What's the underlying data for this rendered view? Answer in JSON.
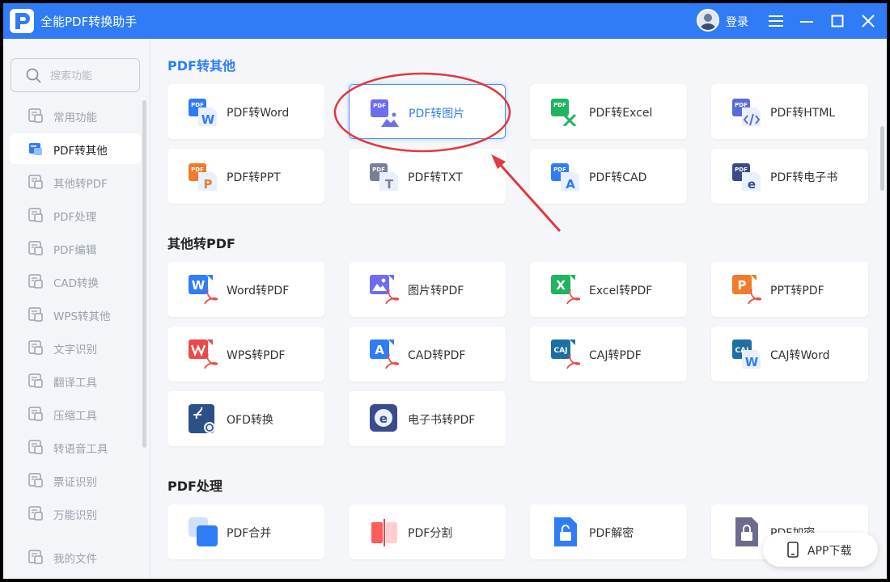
{
  "window": {
    "title": "全能PDF转换助手",
    "login_label": "登录"
  },
  "search": {
    "placeholder": "搜索功能"
  },
  "sidebar": {
    "items": [
      {
        "label": "常用功能",
        "icon": "common-functions-icon"
      },
      {
        "label": "PDF转其他",
        "icon": "pdf-to-other-icon",
        "active": true
      },
      {
        "label": "其他转PDF",
        "icon": "other-to-pdf-icon"
      },
      {
        "label": "PDF处理",
        "icon": "pdf-process-icon"
      },
      {
        "label": "PDF编辑",
        "icon": "pdf-edit-icon"
      },
      {
        "label": "CAD转换",
        "icon": "cad-convert-icon"
      },
      {
        "label": "WPS转其他",
        "icon": "wps-to-other-icon"
      },
      {
        "label": "文字识别",
        "icon": "ocr-icon"
      },
      {
        "label": "翻译工具",
        "icon": "translate-icon"
      },
      {
        "label": "压缩工具",
        "icon": "compress-icon"
      },
      {
        "label": "转语音工具",
        "icon": "text-to-speech-icon"
      },
      {
        "label": "票证识别",
        "icon": "ticket-recognition-icon"
      },
      {
        "label": "万能识别",
        "icon": "universal-recognition-icon"
      },
      {
        "label": "我的文件",
        "icon": "my-files-icon"
      }
    ]
  },
  "sections": {
    "pdf_to_other": {
      "title": "PDF转其他",
      "cards": [
        {
          "label": "PDF转Word"
        },
        {
          "label": "PDF转图片"
        },
        {
          "label": "PDF转Excel"
        },
        {
          "label": "PDF转HTML"
        },
        {
          "label": "PDF转PPT"
        },
        {
          "label": "PDF转TXT"
        },
        {
          "label": "PDF转CAD"
        },
        {
          "label": "PDF转电子书"
        }
      ]
    },
    "other_to_pdf": {
      "title": "其他转PDF",
      "cards": [
        {
          "label": "Word转PDF"
        },
        {
          "label": "图片转PDF"
        },
        {
          "label": "Excel转PDF"
        },
        {
          "label": "PPT转PDF"
        },
        {
          "label": "WPS转PDF"
        },
        {
          "label": "CAD转PDF"
        },
        {
          "label": "CAJ转PDF"
        },
        {
          "label": "CAJ转Word"
        },
        {
          "label": "OFD转换"
        },
        {
          "label": "电子书转PDF"
        }
      ]
    },
    "pdf_process": {
      "title": "PDF处理",
      "cards": [
        {
          "label": "PDF合并"
        },
        {
          "label": "PDF分割"
        },
        {
          "label": "PDF解密"
        },
        {
          "label": "PDF加密"
        }
      ]
    }
  },
  "icon_text": {
    "pdf": "PDF",
    "w": "W",
    "p": "P",
    "t": "T",
    "a": "A",
    "e": "e",
    "caj": "CAJ",
    "x": "X"
  },
  "app_download": {
    "label": "APP下载"
  },
  "colors": {
    "accent": "#2f7cf6",
    "annotation": "#e0393e",
    "word": "#2f7cf6",
    "image": "#6b6ef0",
    "excel": "#22b35e",
    "html": "#5b6bd6",
    "ppt": "#f07b2c",
    "txt": "#7a7f95",
    "wps": "#e84b4b"
  }
}
